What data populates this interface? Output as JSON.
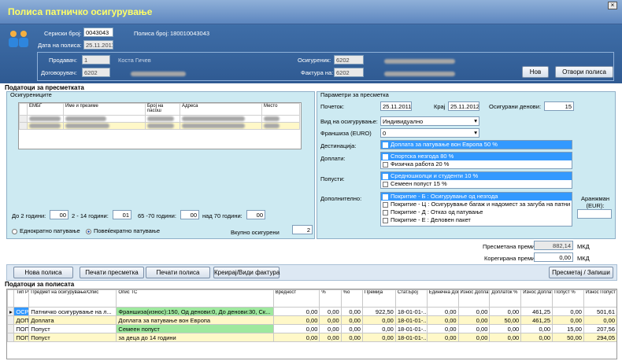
{
  "window": {
    "title": "Полиса патничко осигурување",
    "close_icon": "×"
  },
  "header": {
    "serial_label": "Сериски број:",
    "serial_value": "0043043",
    "date_label": "Дата на полиса:",
    "date_value": "25.11.2011",
    "policy_number_label": "Полиса број:",
    "policy_number_value": "180010043043",
    "seller_label": "Продавач:",
    "seller_code": "1",
    "seller_name": "Коста Гичев",
    "contractor_label": "Договорувач:",
    "contractor_code": "6202",
    "insured_label": "Осигуреник:",
    "insured_code": "6202",
    "invoice_to_label": "Фактура на:",
    "invoice_to_code": "6202",
    "new_button": "Нов",
    "open_policy_button": "Отвори полиса"
  },
  "calc_section": {
    "title": "Податоци за пресметката"
  },
  "insured_panel": {
    "title": "Осигурениците",
    "columns": [
      "ЕМБГ",
      "Име и презиме",
      "Број на пасош",
      "Адреса",
      "Место"
    ],
    "age_up_to_2_label": "До 2 години:",
    "age_up_to_2": "00",
    "age_2_14_label": "2 - 14 години:",
    "age_2_14": "01",
    "age_65_70_label": "65 -70 години:",
    "age_65_70": "00",
    "age_over_70_label": "над 70 години:",
    "age_over_70": "00",
    "single_trip_label": "Еднократно патување",
    "multi_trip_label": "Повеќекратно патување",
    "total_insured_label": "Вкупно осигурени",
    "total_insured": "2"
  },
  "params_panel": {
    "title": "Параметри за пресметка",
    "start_label": "Почеток:",
    "start_value": "25.11.2011",
    "end_label": "Крај",
    "end_value": "25.11.2012",
    "days_label": "Осигурани денови:",
    "days_value": "15",
    "type_label": "Вид на осигурување:",
    "type_value": "Индивидуално",
    "franchise_label": "Франшиза (EURO)",
    "franchise_value": "0",
    "destination_label": "Дестинација:",
    "destinations": [
      "Доплата за патување вон Европа 50 %"
    ],
    "surcharges_label": "Доплати:",
    "surcharges": [
      "Спортска незгода 80 %",
      "Физичка работа 20 %"
    ],
    "discounts_label": "Попусти:",
    "discounts": [
      "Средношколци и студенти 10 %",
      "Семеен попуст 15 %"
    ],
    "additional_label": "Дополнително:",
    "additional": [
      "Покритие - Б : Осигурување од незгода",
      "Покритие - Ц : Осигурување багаж и надомест за загуба на патни д",
      "Покритие - Д : Отказ од патување",
      "Покритие - Е : Деловен пакет"
    ],
    "arrangement_label": "Аранжман (EUR):"
  },
  "premium": {
    "calc_label": "Пресметана премија:",
    "calc_value": "882,14",
    "corrected_label": "Корегирана премија:",
    "corrected_value": "0,00",
    "currency": "МКД"
  },
  "actions": {
    "new_policy": "Нова полиса",
    "print_calc": "Печати пресметка",
    "print_policy": "Печати полиса",
    "invoice": "Креирај/Види фактура",
    "save": "Пресметај / Запиши"
  },
  "policy_table": {
    "title": "Податоци за полисата",
    "columns": [
      "Тип Ризик",
      "Предмет на осигурување/Опис",
      "Опис ТС",
      "Вредност",
      "%",
      "%о",
      "Премија",
      "Стат.Број",
      "Единечна Доплата %",
      "Износ Доплата",
      "Доплаток %",
      "Износ Доплаток",
      "Попуст %",
      "Износ Попуст"
    ],
    "rows": [
      {
        "type": "ОСР",
        "subject": "Патничко осигурување на л...",
        "desc": "Франшиза(износ):150, Од денови:0, До денови:30, Ск...",
        "value": "0,00",
        "pct": "0,00",
        "permil": "0,00",
        "premium": "922,50",
        "stat": "18-01-01-...",
        "unit_surcharge": "0,00",
        "surcharge_amt": "0,00",
        "addon_pct": "0,00",
        "addon_amt": "461,25",
        "discount_pct": "0,00",
        "discount_amt": "501,61"
      },
      {
        "type": "ДОП",
        "subject": "Доплата",
        "desc": "Доплата за патување вон Европа",
        "value": "0,00",
        "pct": "0,00",
        "permil": "0,00",
        "premium": "0,00",
        "stat": "18-01-01-...",
        "unit_surcharge": "0,00",
        "surcharge_amt": "0,00",
        "addon_pct": "50,00",
        "addon_amt": "461,25",
        "discount_pct": "0,00",
        "discount_amt": "0,00"
      },
      {
        "type": "ПОП",
        "subject": "Попуст",
        "desc": "Семеен попуст",
        "value": "0,00",
        "pct": "0,00",
        "permil": "0,00",
        "premium": "0,00",
        "stat": "18-01-01-...",
        "unit_surcharge": "0,00",
        "surcharge_amt": "0,00",
        "addon_pct": "0,00",
        "addon_amt": "0,00",
        "discount_pct": "15,00",
        "discount_amt": "207,56"
      },
      {
        "type": "ПОП",
        "subject": "Попуст",
        "desc": "за деца до 14 години",
        "value": "0,00",
        "pct": "0,00",
        "permil": "0,00",
        "premium": "0,00",
        "stat": "18-01-01-...",
        "unit_surcharge": "0,00",
        "surcharge_amt": "0,00",
        "addon_pct": "0,00",
        "addon_amt": "0,00",
        "discount_pct": "50,00",
        "discount_amt": "294,05"
      }
    ]
  }
}
